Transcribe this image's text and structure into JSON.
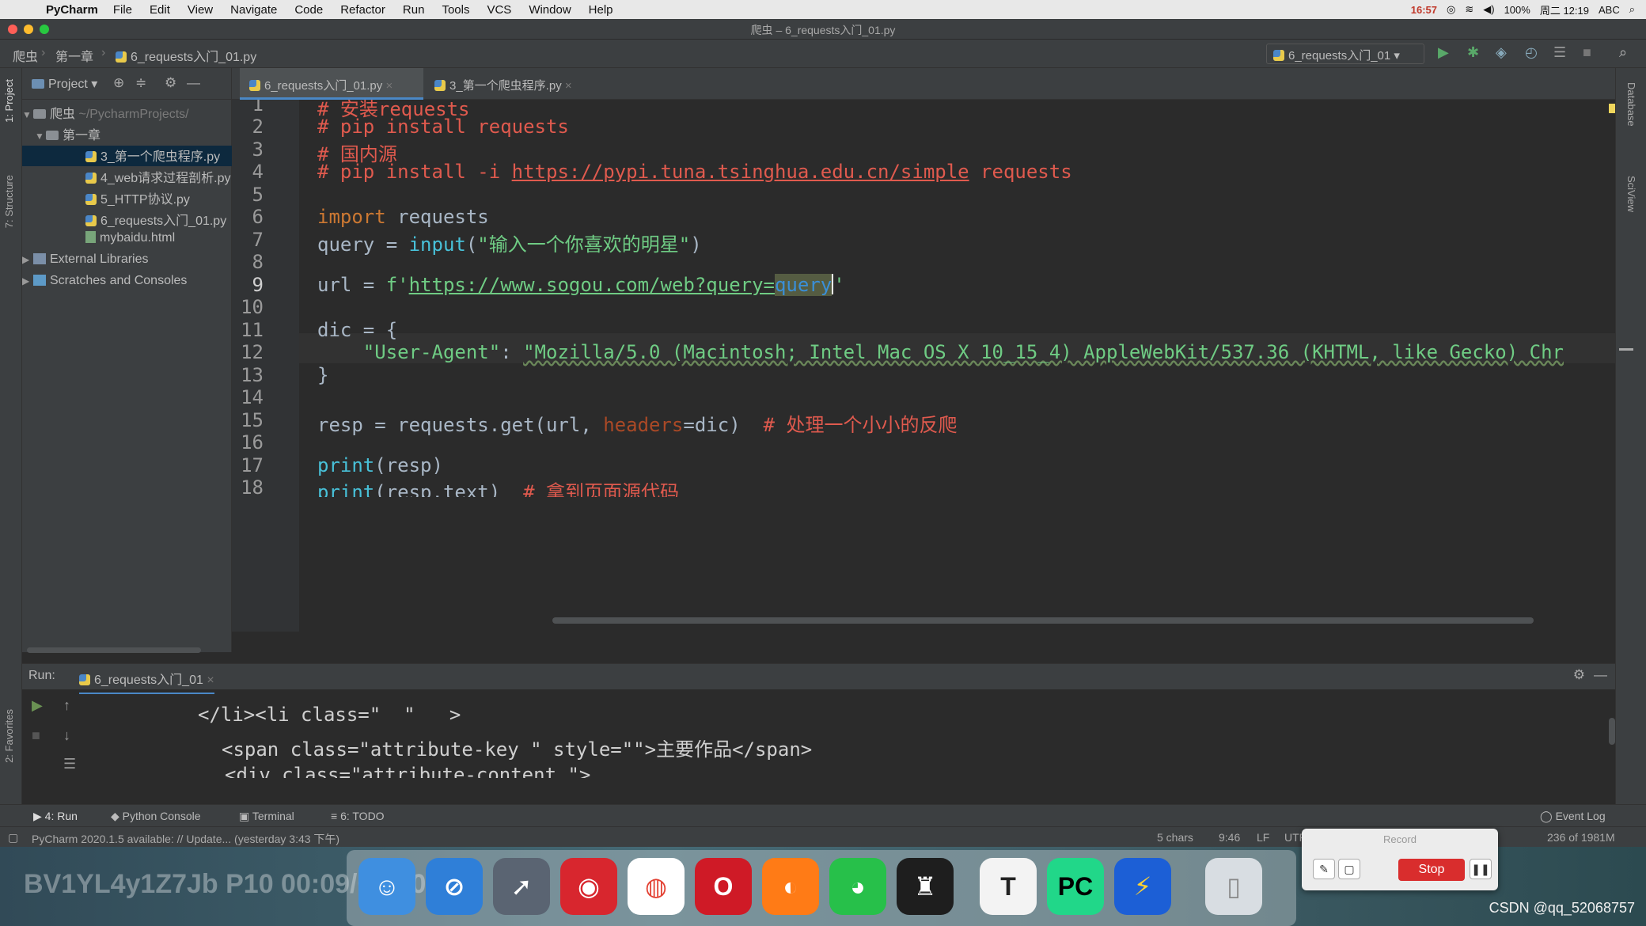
{
  "menubar": {
    "apple": "",
    "app": "PyCharm",
    "items": [
      "File",
      "Edit",
      "View",
      "Navigate",
      "Code",
      "Refactor",
      "Run",
      "Tools",
      "VCS",
      "Window",
      "Help"
    ],
    "right": {
      "rec": "16:57",
      "battery": "100%",
      "clock": "周二 12:19",
      "input": "ABC"
    }
  },
  "window": {
    "title": "爬虫 – 6_requests入门_01.py"
  },
  "navbar": {
    "crumbs": [
      "爬虫",
      "第一章",
      "6_requests入门_01.py"
    ],
    "run_config": "6_requests入门_01"
  },
  "project": {
    "header": "Project",
    "root": {
      "name": "爬虫",
      "path": "~/PycharmProjects/"
    },
    "folder": "第一章",
    "files": [
      "3_第一个爬虫程序.py",
      "4_web请求过程剖析.py",
      "5_HTTP协议.py",
      "6_requests入门_01.py",
      "mybaidu.html"
    ],
    "external": "External Libraries",
    "scratches": "Scratches and Consoles"
  },
  "sidebar_labels": {
    "project": "1: Project",
    "structure": "7: Structure",
    "favorites": "2: Favorites",
    "database": "Database",
    "sciview": "SciView"
  },
  "tabs": [
    {
      "label": "6_requests入门_01.py",
      "active": true
    },
    {
      "label": "3_第一个爬虫程序.py",
      "active": false
    }
  ],
  "editor": {
    "line_numbers": [
      "1",
      "2",
      "3",
      "4",
      "5",
      "6",
      "7",
      "8",
      "9",
      "10",
      "11",
      "12",
      "13",
      "14",
      "15",
      "16",
      "17",
      "18"
    ],
    "l1": "# 安装requests",
    "l2": "# pip install requests",
    "l3": "# 国内源",
    "l4_a": "# pip install -i ",
    "l4_url": "https://pypi.tuna.tsinghua.edu.cn/simple",
    "l4_b": " requests",
    "l6_kw": "import",
    "l6_rest": " requests",
    "l7_a": "query = ",
    "l7_fn": "input",
    "l7_b": "(",
    "l7_str": "\"输入一个你喜欢的明星\"",
    "l7_c": ")",
    "l9_a": "url = ",
    "l9_f": "f'",
    "l9_url": "https://www.sogou.com/web?query=",
    "l9_sel": "query",
    "l9_end": "'",
    "l11": "dic = {",
    "l12_key": "\"User-Agent\"",
    "l12_colon": ": ",
    "l12_val": "\"Mozilla/5.0 (Macintosh; Intel Mac OS X 10_15_4) AppleWebKit/537.36 (KHTML, like Gecko) Chr",
    "l13": "}",
    "l15_a": "resp = requests.get(url, ",
    "l15_param": "headers",
    "l15_b": "=dic)  ",
    "l15_cmt": "# 处理一个小小的反爬",
    "l17_fn": "print",
    "l17_rest": "(resp)",
    "l18_fn": "print",
    "l18_rest": "(resp.text)  ",
    "l18_cmt": "# 拿到页面源代码"
  },
  "run": {
    "label": "Run:",
    "tab": "6_requests入门_01",
    "out1": "</li><li class=\"  \"   >",
    "out2": "<span class=\"attribute-key \" style=\"\">主要作品</span>",
    "out3": "<div class=\"attribute-content \">"
  },
  "bottom_tabs": [
    "4: Run",
    "Python Console",
    "Terminal",
    "6: TODO"
  ],
  "event_log": "Event Log",
  "status": {
    "message": "PyCharm 2020.1.5 available: // Update... (yesterday 3:43 下午)",
    "chars": "5 chars",
    "pos": "9:46",
    "lf": "LF",
    "enc": "UTF-8",
    "mem": "236 of 1981M"
  },
  "recorder": {
    "title": "Record",
    "stop": "Stop"
  },
  "watermark": "BV1YL4y1Z7Jb P10 00:09/08:20",
  "csdn": "CSDN @qq_52068757",
  "dock_icons": [
    "finder-icon",
    "safari-icon",
    "launchpad-icon",
    "netease-music-icon",
    "chrome-icon",
    "opera-icon",
    "firefox-icon",
    "wechat-icon",
    "qq-icon",
    "typora-icon",
    "pycharm-icon",
    "thunder-icon",
    "trash-icon"
  ]
}
